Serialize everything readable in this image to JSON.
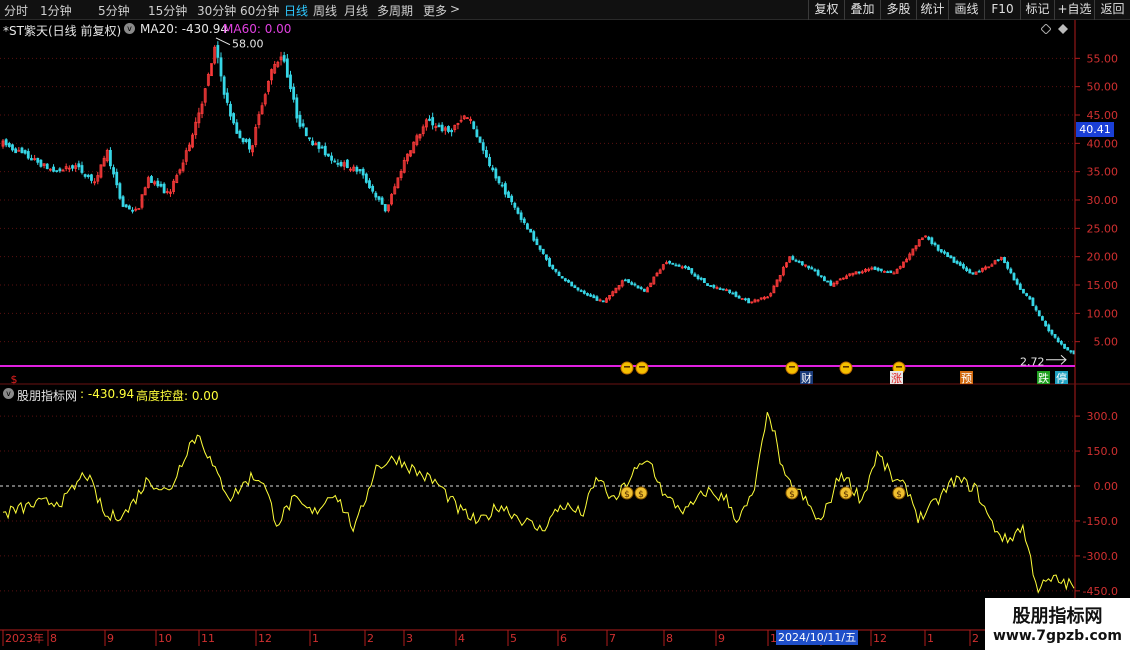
{
  "toolbar": {
    "periods": [
      "分时",
      "1分钟",
      "5分钟",
      "15分钟",
      "30分钟",
      "60分钟",
      "日线",
      "周线",
      "月线",
      "多周期",
      "更多"
    ],
    "active_period": "日线",
    "more_arrow": ">",
    "right_buttons": [
      "复权",
      "叠加",
      "多股",
      "统计",
      "画线",
      "F10",
      "标记",
      "+自选",
      "返回"
    ]
  },
  "main_panel": {
    "stock_title": "*ST紫天(日线 前复权)",
    "ma20_label": "MA20: -430.94",
    "ma60_label": "MA60: 0.00",
    "high_label": "58.00",
    "low_label": "2.72",
    "current_price_tag": "40.41",
    "price_axis": [
      "55.00",
      "50.00",
      "45.00",
      "40.00",
      "35.00",
      "30.00",
      "25.00",
      "20.00",
      "15.00",
      "10.00",
      "5.00"
    ]
  },
  "sub_panel": {
    "indicator_name": "股朋指标网",
    "indicator_value": ": -430.94",
    "control_label": "高度控盘: 0.00",
    "value_axis": [
      "300.0",
      "150.0",
      "0.00",
      "-150.0",
      "-300.0",
      "-450.0"
    ]
  },
  "markers": {
    "dollar_left": "$",
    "cai": "财",
    "zhang": "涨",
    "yu": "预",
    "die": "跌",
    "ting": "停"
  },
  "time_axis": {
    "labels": [
      "2023年",
      "8",
      "9",
      "10",
      "11",
      "12",
      "1",
      "2",
      "3",
      "4",
      "5",
      "6",
      "7",
      "8",
      "9",
      "10",
      "11",
      "12",
      "1",
      "2"
    ],
    "selected_date": "2024/10/11/五"
  },
  "watermark": {
    "title": "股朋指标网",
    "url": "www.7gpzb.com"
  },
  "colors": {
    "up": "#ff3b3b",
    "down": "#37d6e6",
    "indicator_line": "#ffff3a",
    "baseline": "#e020e0",
    "axis": "#b01c1c",
    "ma60": "#e040e0",
    "active_period": "#2ec8ff"
  },
  "chart_data": {
    "type": "candlestick_with_indicator",
    "price_range": [
      0,
      60
    ],
    "indicator_range": [
      -480,
      380
    ],
    "price_path": [
      [
        0,
        40
      ],
      [
        0.03,
        37
      ],
      [
        0.05,
        35
      ],
      [
        0.07,
        36
      ],
      [
        0.09,
        33
      ],
      [
        0.1,
        39
      ],
      [
        0.115,
        29
      ],
      [
        0.13,
        28
      ],
      [
        0.14,
        34
      ],
      [
        0.16,
        31
      ],
      [
        0.175,
        37
      ],
      [
        0.18,
        40
      ],
      [
        0.195,
        49
      ],
      [
        0.205,
        57
      ],
      [
        0.215,
        48
      ],
      [
        0.225,
        42
      ],
      [
        0.24,
        39
      ],
      [
        0.25,
        47
      ],
      [
        0.26,
        53
      ],
      [
        0.27,
        56
      ],
      [
        0.285,
        44
      ],
      [
        0.3,
        40
      ],
      [
        0.32,
        37
      ],
      [
        0.345,
        35
      ],
      [
        0.37,
        28
      ],
      [
        0.39,
        38
      ],
      [
        0.41,
        44
      ],
      [
        0.43,
        42
      ],
      [
        0.45,
        45
      ],
      [
        0.47,
        36
      ],
      [
        0.49,
        30
      ],
      [
        0.51,
        24
      ],
      [
        0.53,
        18
      ],
      [
        0.555,
        14
      ],
      [
        0.58,
        12
      ],
      [
        0.6,
        16
      ],
      [
        0.62,
        14
      ],
      [
        0.64,
        19
      ],
      [
        0.66,
        18
      ],
      [
        0.68,
        15
      ],
      [
        0.7,
        14
      ],
      [
        0.72,
        12
      ],
      [
        0.74,
        13
      ],
      [
        0.76,
        20
      ],
      [
        0.78,
        18
      ],
      [
        0.8,
        15
      ],
      [
        0.82,
        17
      ],
      [
        0.84,
        18
      ],
      [
        0.86,
        17
      ],
      [
        0.875,
        20
      ],
      [
        0.89,
        24
      ],
      [
        0.905,
        21
      ],
      [
        0.92,
        19
      ],
      [
        0.935,
        17
      ],
      [
        0.95,
        18
      ],
      [
        0.965,
        20
      ],
      [
        0.98,
        15
      ],
      [
        0.99,
        13
      ],
      [
        1.0,
        10
      ],
      [
        1.01,
        7
      ],
      [
        1.025,
        4
      ],
      [
        1.035,
        3
      ]
    ],
    "indicator_path": [
      [
        0,
        -120
      ],
      [
        0.03,
        -80
      ],
      [
        0.06,
        -60
      ],
      [
        0.08,
        60
      ],
      [
        0.1,
        -140
      ],
      [
        0.12,
        -110
      ],
      [
        0.14,
        30
      ],
      [
        0.16,
        -30
      ],
      [
        0.18,
        180
      ],
      [
        0.19,
        220
      ],
      [
        0.205,
        60
      ],
      [
        0.22,
        -50
      ],
      [
        0.24,
        40
      ],
      [
        0.25,
        30
      ],
      [
        0.265,
        -160
      ],
      [
        0.28,
        -60
      ],
      [
        0.3,
        -120
      ],
      [
        0.32,
        -20
      ],
      [
        0.34,
        -190
      ],
      [
        0.36,
        80
      ],
      [
        0.38,
        120
      ],
      [
        0.4,
        60
      ],
      [
        0.42,
        10
      ],
      [
        0.44,
        -100
      ],
      [
        0.46,
        -160
      ],
      [
        0.48,
        -80
      ],
      [
        0.5,
        -140
      ],
      [
        0.52,
        -190
      ],
      [
        0.54,
        -80
      ],
      [
        0.56,
        -120
      ],
      [
        0.575,
        40
      ],
      [
        0.59,
        -70
      ],
      [
        0.61,
        60
      ],
      [
        0.625,
        110
      ],
      [
        0.64,
        -50
      ],
      [
        0.66,
        -110
      ],
      [
        0.68,
        -20
      ],
      [
        0.7,
        -60
      ],
      [
        0.71,
        -150
      ],
      [
        0.725,
        -40
      ],
      [
        0.74,
        330
      ],
      [
        0.755,
        30
      ],
      [
        0.77,
        -30
      ],
      [
        0.79,
        -160
      ],
      [
        0.81,
        60
      ],
      [
        0.83,
        -60
      ],
      [
        0.845,
        140
      ],
      [
        0.86,
        30
      ],
      [
        0.875,
        -20
      ],
      [
        0.885,
        -140
      ],
      [
        0.9,
        -80
      ],
      [
        0.92,
        30
      ],
      [
        0.94,
        -10
      ],
      [
        0.955,
        -160
      ],
      [
        0.97,
        -240
      ],
      [
        0.985,
        -170
      ],
      [
        1.0,
        -440
      ],
      [
        1.015,
        -400
      ],
      [
        1.035,
        -430
      ]
    ]
  }
}
